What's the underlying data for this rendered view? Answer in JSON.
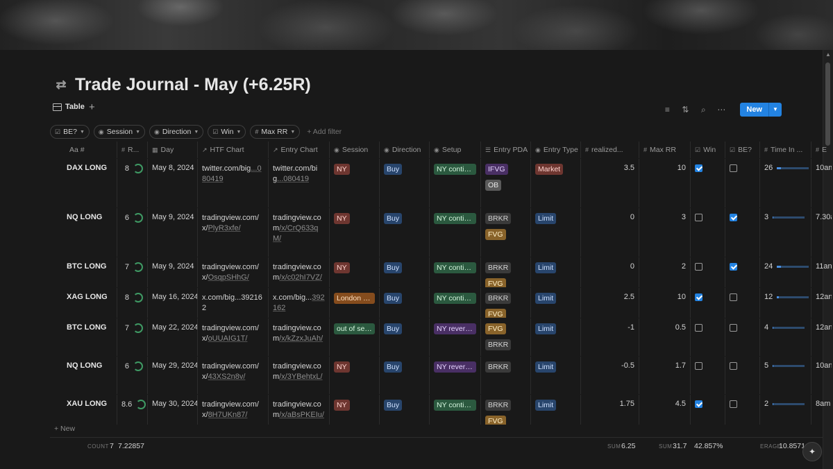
{
  "page": {
    "title": "Trade Journal - May (+6.25R)",
    "icon": "currency-exchange-icon"
  },
  "view": {
    "tab_label": "Table",
    "add_view": "+",
    "new_button": "New"
  },
  "filters": [
    {
      "label": "BE?",
      "icon": "checkbox-icon"
    },
    {
      "label": "Session",
      "icon": "select-icon"
    },
    {
      "label": "Direction",
      "icon": "select-icon"
    },
    {
      "label": "Win",
      "icon": "checkbox-icon"
    },
    {
      "label": "Max RR",
      "icon": "number-icon"
    }
  ],
  "add_filter": "+ Add filter",
  "columns": [
    "Aa #",
    "R...",
    "Day",
    "HTF Chart",
    "Entry Chart",
    "Session",
    "Direction",
    "Setup",
    "Entry PDA",
    "Entry Type",
    "realized...",
    "Max RR",
    "Win",
    "BE?",
    "Time In ...",
    "E"
  ],
  "rows": [
    {
      "name": "DAX LONG",
      "r": "8",
      "day": "May 8, 2024",
      "htf": [
        "twitter.com/big",
        "...080419"
      ],
      "entry": [
        "twitter.com/big",
        "...080419"
      ],
      "session": "NY",
      "direction": "Buy",
      "setup": "NY contin...",
      "pda": [
        "IFVG",
        "OB"
      ],
      "type": "Market",
      "realized": "3.5",
      "maxrr": "10",
      "win": true,
      "be": false,
      "time": "26",
      "extra": "10am"
    },
    {
      "name": "NQ LONG",
      "r": "6",
      "day": "May 9, 2024",
      "htf": [
        "tradingview.com/x/",
        "PlyR3xfe/"
      ],
      "entry": [
        "tradingview.com",
        "/x/CrQ633qM/"
      ],
      "session": "NY",
      "direction": "Buy",
      "setup": "NY contin...",
      "pda": [
        "BRKR",
        "FVG"
      ],
      "type": "Limit",
      "realized": "0",
      "maxrr": "3",
      "win": false,
      "be": true,
      "time": "3",
      "extra": "7.30a"
    },
    {
      "name": "BTC LONG",
      "r": "7",
      "day": "May 9, 2024",
      "htf": [
        "tradingview.com/x/",
        "OsqpSHhG/"
      ],
      "entry": [
        "tradingview.com",
        "/x/c02hI7VZ/"
      ],
      "session": "NY",
      "direction": "Buy",
      "setup": "NY contin...",
      "pda": [
        "BRKR",
        "FVG"
      ],
      "type": "Limit",
      "realized": "0",
      "maxrr": "2",
      "win": false,
      "be": true,
      "time": "24",
      "extra": "11an"
    },
    {
      "name": "XAG LONG",
      "r": "8",
      "day": "May 16, 2024",
      "htf": [
        "x.com/big...392162",
        ""
      ],
      "entry": [
        "x.com/big...",
        "392162"
      ],
      "session": "London C...",
      "direction": "Buy",
      "setup": "NY contin...",
      "pda": [
        "BRKR",
        "FVG"
      ],
      "type": "Limit",
      "realized": "2.5",
      "maxrr": "10",
      "win": true,
      "be": false,
      "time": "12",
      "extra": "12an"
    },
    {
      "name": "BTC LONG",
      "r": "7",
      "day": "May 22, 2024",
      "htf": [
        "tradingview.com/x/",
        "oUUAIG1T/"
      ],
      "entry": [
        "tradingview.com",
        "/x/kZzxJuAh/"
      ],
      "session": "out of ses...",
      "direction": "Buy",
      "setup": "NY reversal",
      "pda": [
        "FVG",
        "BRKR"
      ],
      "type": "Limit",
      "realized": "-1",
      "maxrr": "0.5",
      "win": false,
      "be": false,
      "time": "4",
      "extra": "12an"
    },
    {
      "name": "NQ LONG",
      "r": "6",
      "day": "May 29, 2024",
      "htf": [
        "tradingview.com/x/",
        "43XS2n8v/"
      ],
      "entry": [
        "tradingview.com",
        "/x/3YBehtxL/"
      ],
      "session": "NY",
      "direction": "Buy",
      "setup": "NY reversal",
      "pda": [
        "BRKR"
      ],
      "type": "Limit",
      "realized": "-0.5",
      "maxrr": "1.7",
      "win": false,
      "be": false,
      "time": "5",
      "extra": "10an"
    },
    {
      "name": "XAU LONG",
      "r": "8.6",
      "day": "May 30, 2024",
      "htf": [
        "tradingview.com/x/",
        "8H7UKn87/"
      ],
      "entry": [
        "tradingview.com",
        "/x/aBsPKEIu/"
      ],
      "session": "NY",
      "direction": "Buy",
      "setup": "NY contin...",
      "pda": [
        "BRKR",
        "FVG"
      ],
      "type": "Limit",
      "realized": "1.75",
      "maxrr": "4.5",
      "win": true,
      "be": false,
      "time": "2",
      "extra": "8am"
    }
  ],
  "new_row": "+ New",
  "footer": {
    "count_label": "COUNT",
    "count_value": "7",
    "r_avg": "7.22857",
    "sum_label": "SUM",
    "realized_sum": "6.25",
    "maxrr_sum": "31.7",
    "win_pct": "42.857%",
    "avg_label": "ERAGE",
    "time_avg": "10.8571"
  },
  "colors": {
    "background": "#191919",
    "accent": "#2383e2",
    "tag_red": "#6e3630",
    "tag_blue": "#28456c",
    "tag_green": "#2b593f",
    "tag_purple": "#492f64",
    "tag_orange": "#854c1d",
    "tag_yellow": "#89632a"
  }
}
